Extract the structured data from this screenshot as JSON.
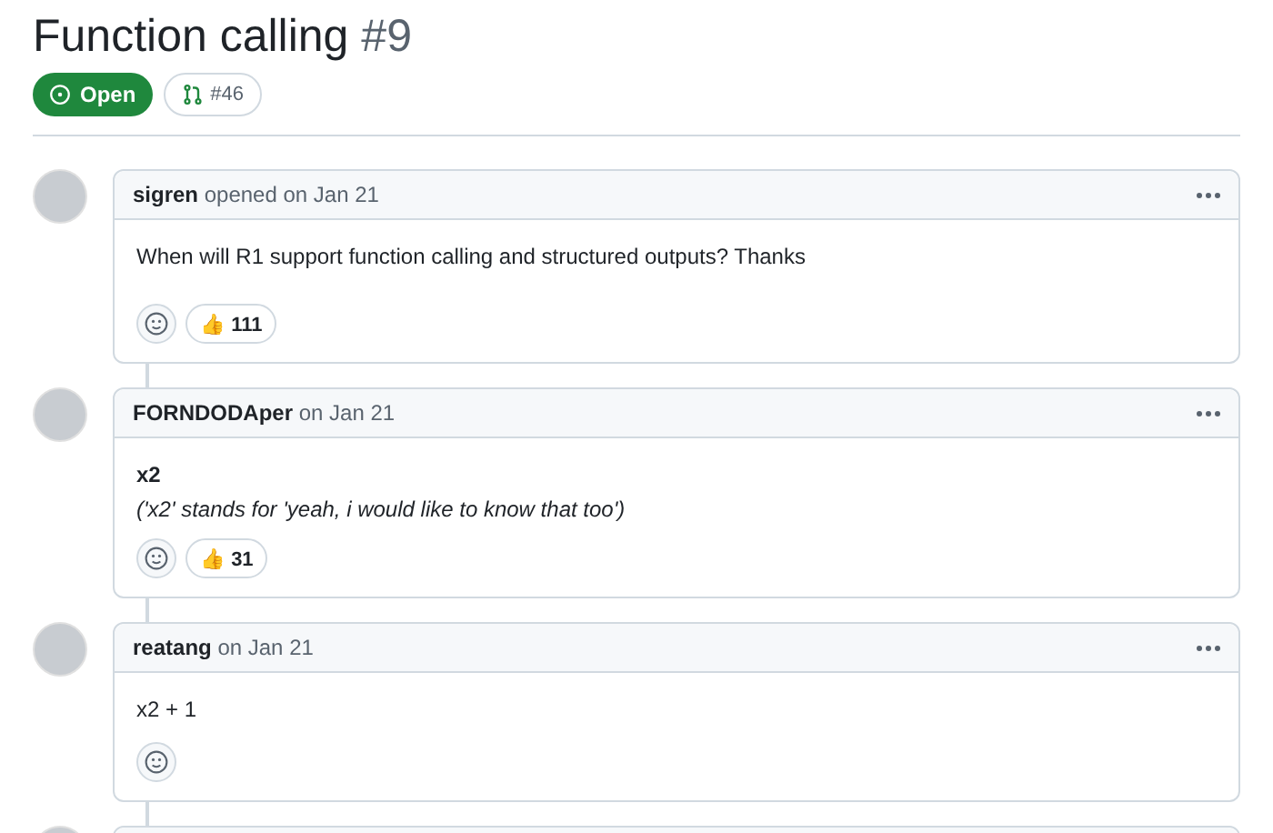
{
  "issue": {
    "title": "Function calling",
    "number": "#9",
    "state": {
      "label": "Open",
      "kind": "open"
    },
    "linked_pr": "#46"
  },
  "comments": [
    {
      "kind": "full",
      "author": "sigren",
      "action": "opened on Jan 21",
      "body": [
        {
          "kind": "plain",
          "text": "When will R1 support function calling and structured outputs? Thanks"
        }
      ],
      "reactions": [
        {
          "emoji": "👍",
          "count": "111"
        }
      ]
    },
    {
      "kind": "full",
      "author": "FORNDODAper",
      "action": "on Jan 21",
      "body": [
        {
          "kind": "bold",
          "text": "x2"
        },
        {
          "kind": "italic",
          "text": "('x2' stands for 'yeah, i would like to know that too')"
        }
      ],
      "reactions": [
        {
          "emoji": "👍",
          "count": "31"
        }
      ]
    },
    {
      "kind": "full",
      "author": "reatang",
      "action": "on Jan 21",
      "body": [
        {
          "kind": "plain",
          "text": "x2 + 1"
        }
      ]
    },
    {
      "kind": "cut_off"
    }
  ]
}
